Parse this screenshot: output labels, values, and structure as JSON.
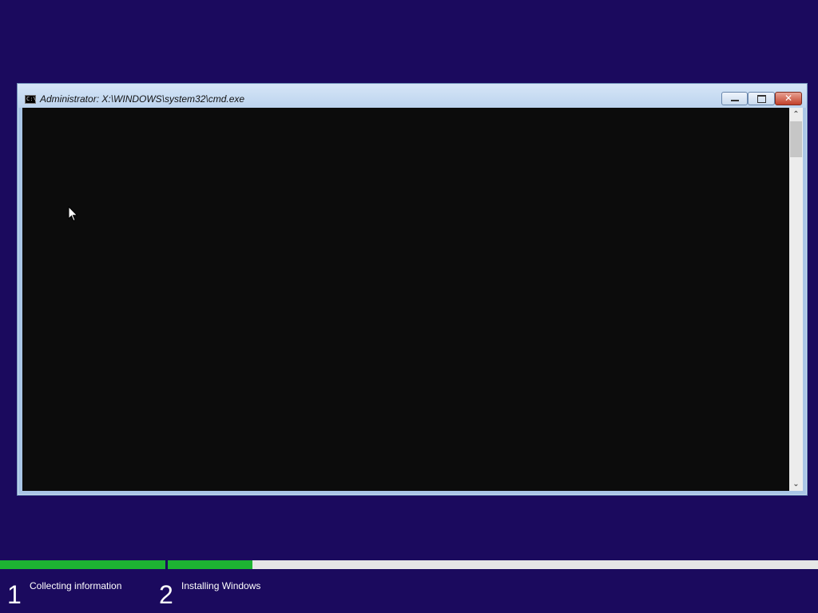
{
  "window": {
    "title": "Administrator: X:\\WINDOWS\\system32\\cmd.exe",
    "icon_text": "C:\\",
    "close_glyph": "✕"
  },
  "scrollbar": {
    "up_arrow": "⌃",
    "down_arrow": "⌄"
  },
  "setup": {
    "steps": [
      {
        "number": "1",
        "label": "Collecting information",
        "progress": 1.0
      },
      {
        "number": "2",
        "label": "Installing Windows",
        "progress": 0.13
      }
    ]
  },
  "colors": {
    "background": "#1b0a5e",
    "progress_fill": "#1db432",
    "console": "#0c0c0c"
  }
}
